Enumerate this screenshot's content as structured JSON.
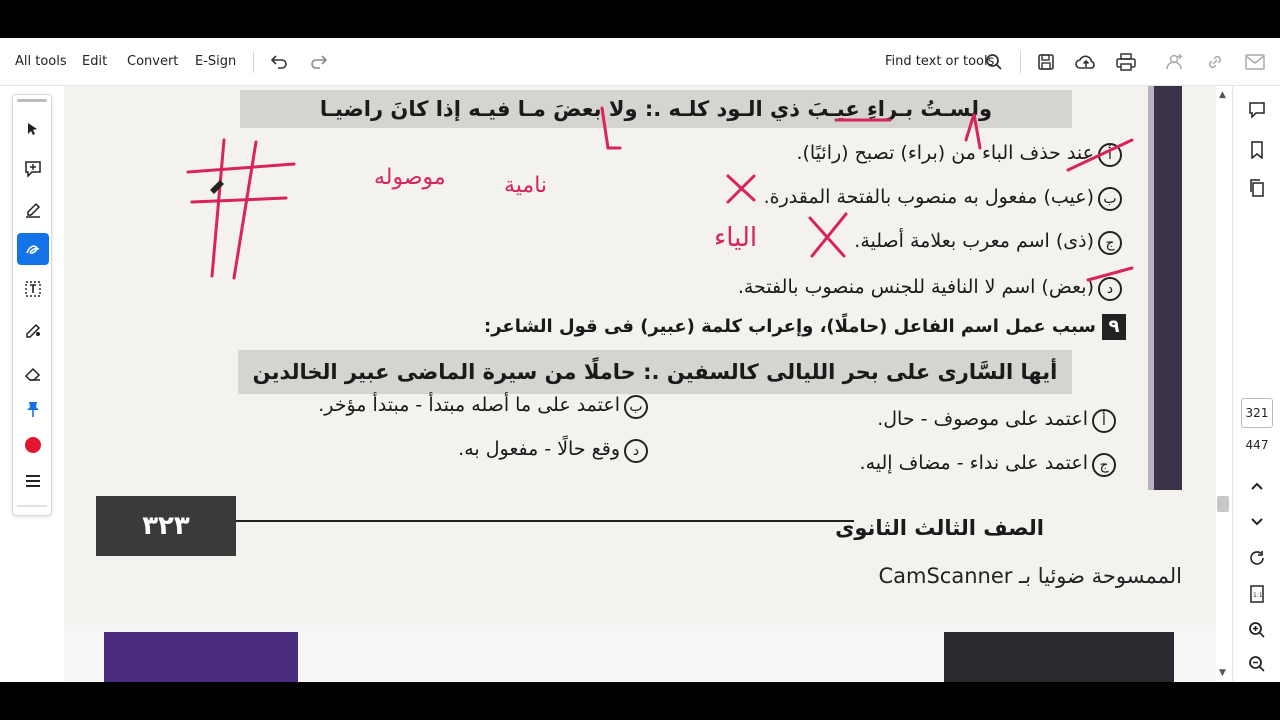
{
  "toolbar": {
    "menu": [
      "All tools",
      "Edit",
      "Convert",
      "E-Sign"
    ],
    "find_label": "Find text or tools",
    "icons": [
      "undo-icon",
      "redo-icon",
      "search-icon",
      "save-icon",
      "upload-cloud-icon",
      "print-icon",
      "share-user-icon",
      "link-icon",
      "mail-icon"
    ]
  },
  "left_tools": [
    "select-arrow-icon",
    "add-comment-icon",
    "highlight-pen-icon",
    "freehand-draw-icon",
    "text-box-icon",
    "fill-sign-icon",
    "eraser-icon",
    "pin-icon",
    "color-dot-icon",
    "more-menu-icon"
  ],
  "page": {
    "verse1": "ولسـتُ بـراءٍ عيـبَ ذي الـود كلـه .: ولا بعضَ مـا فيـه إذا كانَ راضيـا",
    "q_options": [
      "عند حذف الباء من (براء) تصبح (رائيًا).",
      "(عيب) مفعول به منصوب بالفتحة المقدرة.",
      "(ذى) اسم معرب بعلامة أصلية.",
      "(بعض) اسم لا النافية للجنس منصوب بالفتحة."
    ],
    "q_option_letters": [
      "أ",
      "ب",
      "ج",
      "د"
    ],
    "q9_number": "٩",
    "q9_text": "سبب عمل اسم الفاعل (حاملًا)، وإعراب كلمة (عبير) فى قول الشاعر:",
    "verse2": "أيها السَّارى على بحر الليالى كالسفين .: حاملًا من سيرة الماضى عبير الخالدين",
    "q9_options_right": [
      "اعتمد على موصوف - حال.",
      "اعتمد على نداء - مضاف إليه."
    ],
    "q9_letters_right": [
      "أ",
      "ج"
    ],
    "q9_options_left": [
      "اعتمد على ما أصله مبتدأ - مبتدأ مؤخر.",
      "وقع حالًا - مفعول به."
    ],
    "q9_letters_left": [
      "ب",
      "د"
    ],
    "page_number": "٣٢٣",
    "footer_title": "الصف الثالث الثانوى",
    "camscanner": "الممسوحة ضوئيا بـ CamScanner",
    "handwriting": [
      "نامية",
      "موصوله",
      "الياء"
    ]
  },
  "right_rail": {
    "page_current": "321",
    "page_total": "447",
    "icons": [
      "comment-icon",
      "bookmark-icon",
      "copy-pages-icon",
      "chevron-up-icon",
      "chevron-down-icon",
      "rotate-icon",
      "fit-page-icon",
      "zoom-in-icon",
      "zoom-out-icon"
    ]
  },
  "colors": {
    "accent": "#1473e6",
    "ink": "#d8245a",
    "page": "#f3f2ef"
  }
}
